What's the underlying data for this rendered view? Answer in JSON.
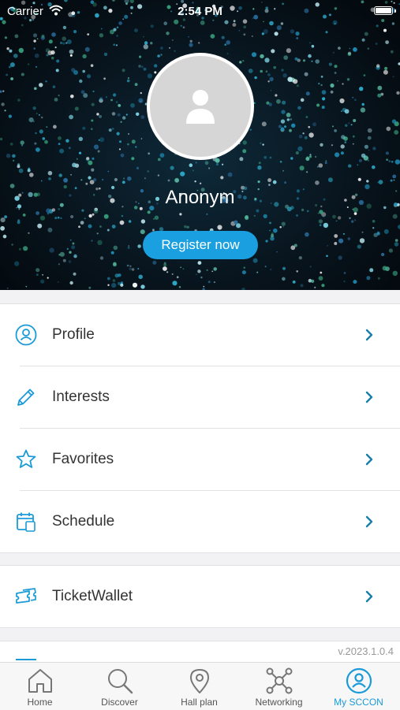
{
  "status_bar": {
    "carrier": "Carrier",
    "time": "2:54 PM"
  },
  "profile": {
    "name": "Anonym",
    "register_label": "Register now"
  },
  "menu": {
    "group1": [
      {
        "label": "Profile",
        "icon": "person-circle-icon"
      },
      {
        "label": "Interests",
        "icon": "pencil-icon"
      },
      {
        "label": "Favorites",
        "icon": "star-icon"
      },
      {
        "label": "Schedule",
        "icon": "calendar-icon"
      }
    ],
    "group2": [
      {
        "label": "TicketWallet",
        "icon": "ticket-icon"
      }
    ]
  },
  "version": "v.2023.1.0.4",
  "tabs": [
    {
      "label": "Home",
      "icon": "home-icon"
    },
    {
      "label": "Discover",
      "icon": "search-icon"
    },
    {
      "label": "Hall plan",
      "icon": "map-pin-icon"
    },
    {
      "label": "Networking",
      "icon": "network-icon"
    },
    {
      "label": "My SCCON",
      "icon": "user-circle-icon",
      "active": true
    }
  ],
  "colors": {
    "accent": "#1a9bd8",
    "button": "#1aa0e0",
    "hero": "#08141d"
  }
}
